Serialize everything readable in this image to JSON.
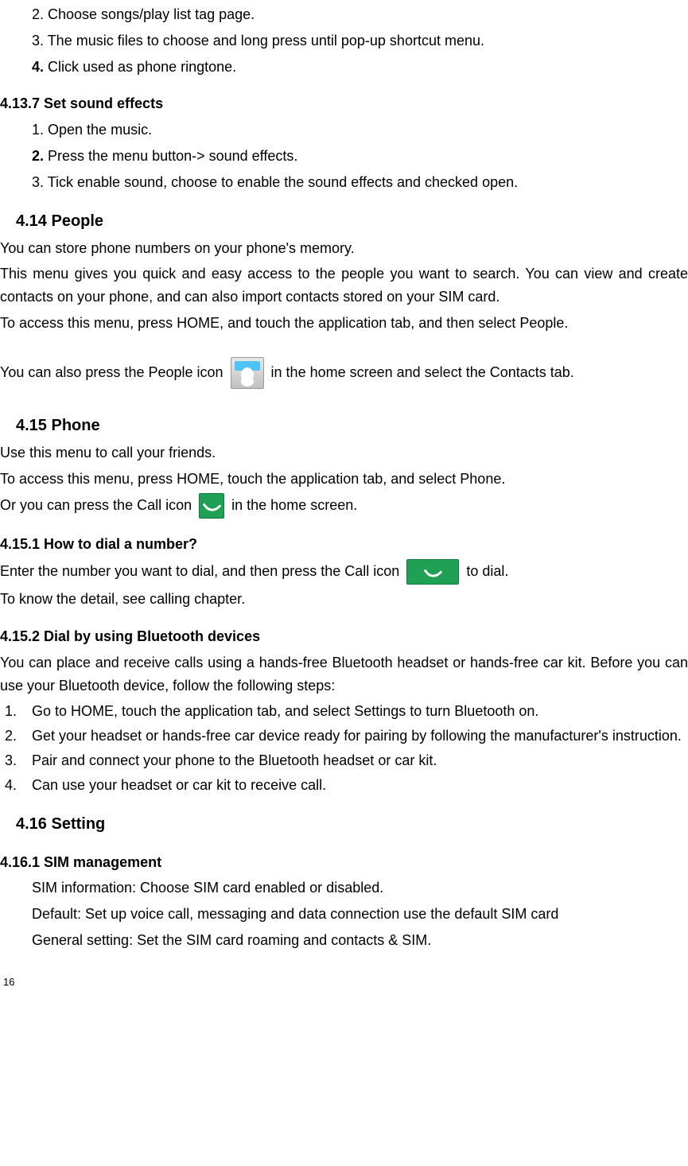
{
  "s4137": {
    "step2": "2. Choose songs/play list tag page.",
    "step3": "3. The music files to choose and long press until pop-up shortcut menu.",
    "step4_num": "4.",
    "step4_text": " Click used as phone ringtone."
  },
  "s4137b_title": "4.13.7  Set sound effects",
  "s4137b": {
    "step1": "1. Open the music.",
    "step2_num": "2.",
    "step2_text": " Press the menu button-> sound effects.",
    "step3": "3. Tick enable sound, choose to enable the sound effects and checked open."
  },
  "s414_title": "4.14 People",
  "s414": {
    "p1": "You can store phone numbers on your phone's memory.",
    "p2": "This menu gives you quick and easy access to the people you want to search. You can view and create contacts on your phone, and can also import contacts stored on your SIM card.",
    "p3": "To access this menu, press HOME, and touch the application tab, and then select People.",
    "p4_a": "You can also press the People icon ",
    "p4_b": " in the home screen and select the Contacts tab."
  },
  "s415_title": "4.15 Phone",
  "s415": {
    "p1": "Use this menu to call your friends.",
    "p2": "To access this menu, press HOME, touch the application tab, and select Phone.",
    "p3_a": "Or you can press the Call icon ",
    "p3_b": " in the home screen."
  },
  "s4151_title": "4.15.1  How to dial a number?",
  "s4151": {
    "p1_a": "Enter the number you want to dial, and then press the Call icon ",
    "p1_b": " to dial.",
    "p2": "To know the detail, see calling chapter."
  },
  "s4152_title": "4.15.2  Dial by using Bluetooth devices",
  "s4152": {
    "p1": "You can place and receive calls using a hands-free Bluetooth headset or hands-free car kit. Before you can use your Bluetooth device, follow the following steps:",
    "li1": "Go to HOME, touch the application tab, and select Settings to turn Bluetooth on.",
    "li2": "Get your headset or hands-free car device ready for pairing by following the manufacturer's instruction.",
    "li3": "Pair and connect your phone to the Bluetooth headset or car kit.",
    "li4": "Can use your headset or car kit to receive call."
  },
  "s416_title": "4.16 Setting",
  "s4161_title": "4.16.1  SIM management",
  "s4161": {
    "p1": "SIM information: Choose SIM card enabled or disabled.",
    "p2": "Default: Set up voice call, messaging and data connection use the default SIM card",
    "p3": "General setting: Set the SIM card roaming and contacts & SIM."
  },
  "page_number": "16"
}
